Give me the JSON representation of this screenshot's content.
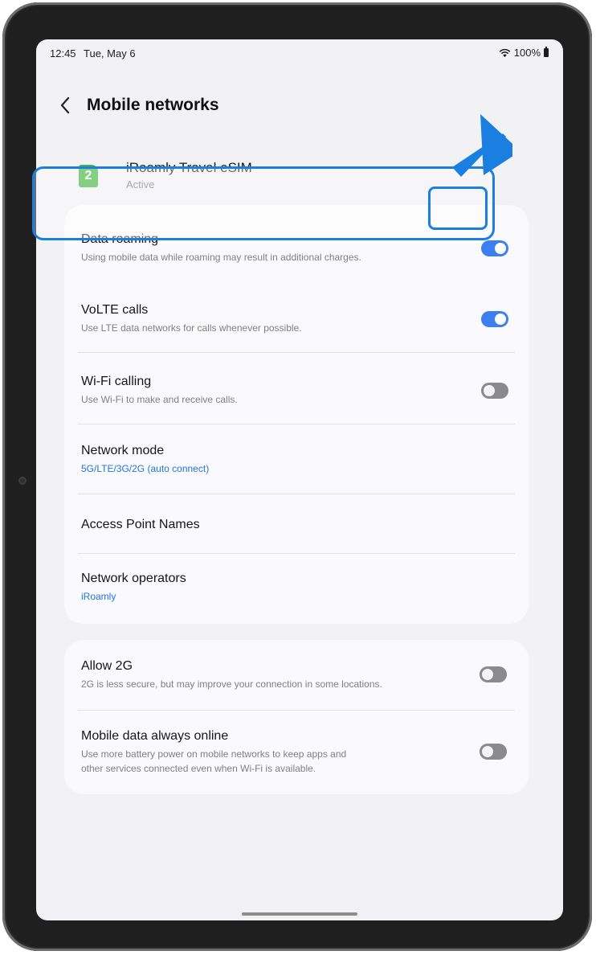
{
  "status_bar": {
    "time": "12:45",
    "date": "Tue, May 6",
    "battery": "100%",
    "icons": [
      "wifi-icon",
      "battery-icon"
    ]
  },
  "header": {
    "title": "Mobile networks",
    "back_icon": "chevron-left-icon"
  },
  "sim": {
    "badge": "2",
    "name": "iRoamly Travel eSIM",
    "status": "Active",
    "badge_color": "#43b540"
  },
  "settings_main": [
    {
      "title": "Data roaming",
      "subtitle": "Using mobile data while roaming may result in additional charges.",
      "toggle": true
    },
    {
      "title": "VoLTE calls",
      "subtitle": "Use LTE data networks for calls whenever possible.",
      "toggle": true
    },
    {
      "title": "Wi-Fi calling",
      "subtitle": "Use Wi-Fi to make and receive calls.",
      "toggle": false
    },
    {
      "title": "Network mode",
      "subtitle": "5G/LTE/3G/2G (auto connect)"
    },
    {
      "title": "Access Point Names"
    },
    {
      "title": "Network operators",
      "subtitle": "iRoamly"
    }
  ],
  "settings_extra": [
    {
      "title": "Allow 2G",
      "subtitle": "2G is less secure, but may improve your connection in some locations.",
      "toggle": false
    },
    {
      "title": "Mobile data always online",
      "subtitle_line1": "Use more battery power on mobile networks to keep apps and",
      "subtitle_line2": "other services connected even when Wi-Fi is available.",
      "toggle": false
    }
  ],
  "colors": {
    "accent": "#3b7ff0",
    "highlight": "#1a7fe0",
    "link": "#1f74e0",
    "toggle_off": "#8a8a8e"
  }
}
